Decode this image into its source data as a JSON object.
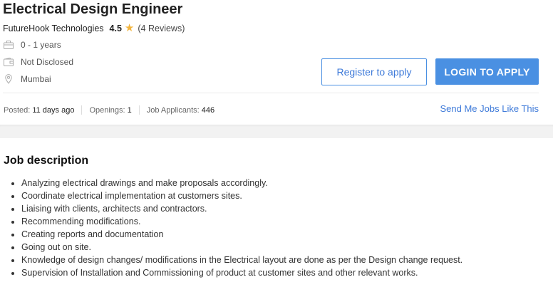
{
  "job": {
    "title": "Electrical Design Engineer",
    "company": "FutureHook Technologies",
    "rating": "4.5",
    "reviews": "(4 Reviews)",
    "experience": "0 - 1 years",
    "salary": "Not Disclosed",
    "location": "Mumbai"
  },
  "actions": {
    "register_label": "Register to apply",
    "login_label": "LOGIN TO APPLY",
    "send_jobs_label": "Send Me Jobs Like This"
  },
  "stats": {
    "posted_label": "Posted:",
    "posted_value": "11 days ago",
    "openings_label": "Openings:",
    "openings_value": "1",
    "applicants_label": "Job Applicants:",
    "applicants_value": "446"
  },
  "description": {
    "heading": "Job description",
    "items": [
      "Analyzing electrical drawings and make proposals accordingly.",
      "Coordinate electrical implementation at customers sites.",
      "Liaising with clients, architects and contractors.",
      "Recommending modifications.",
      "Creating reports and documentation",
      "Going out on site.",
      "Knowledge of design changes/ modifications in the Electrical layout are done as per the Design change request.",
      "Supervision of Installation and Commissioning of product at customer sites and other relevant works."
    ]
  },
  "icons": {
    "star": "star-icon",
    "experience": "briefcase-icon",
    "salary": "wallet-icon",
    "location": "location-pin-icon"
  },
  "colors": {
    "accent": "#4a90e2",
    "link": "#3e7ad9",
    "star": "#f3b53f"
  }
}
